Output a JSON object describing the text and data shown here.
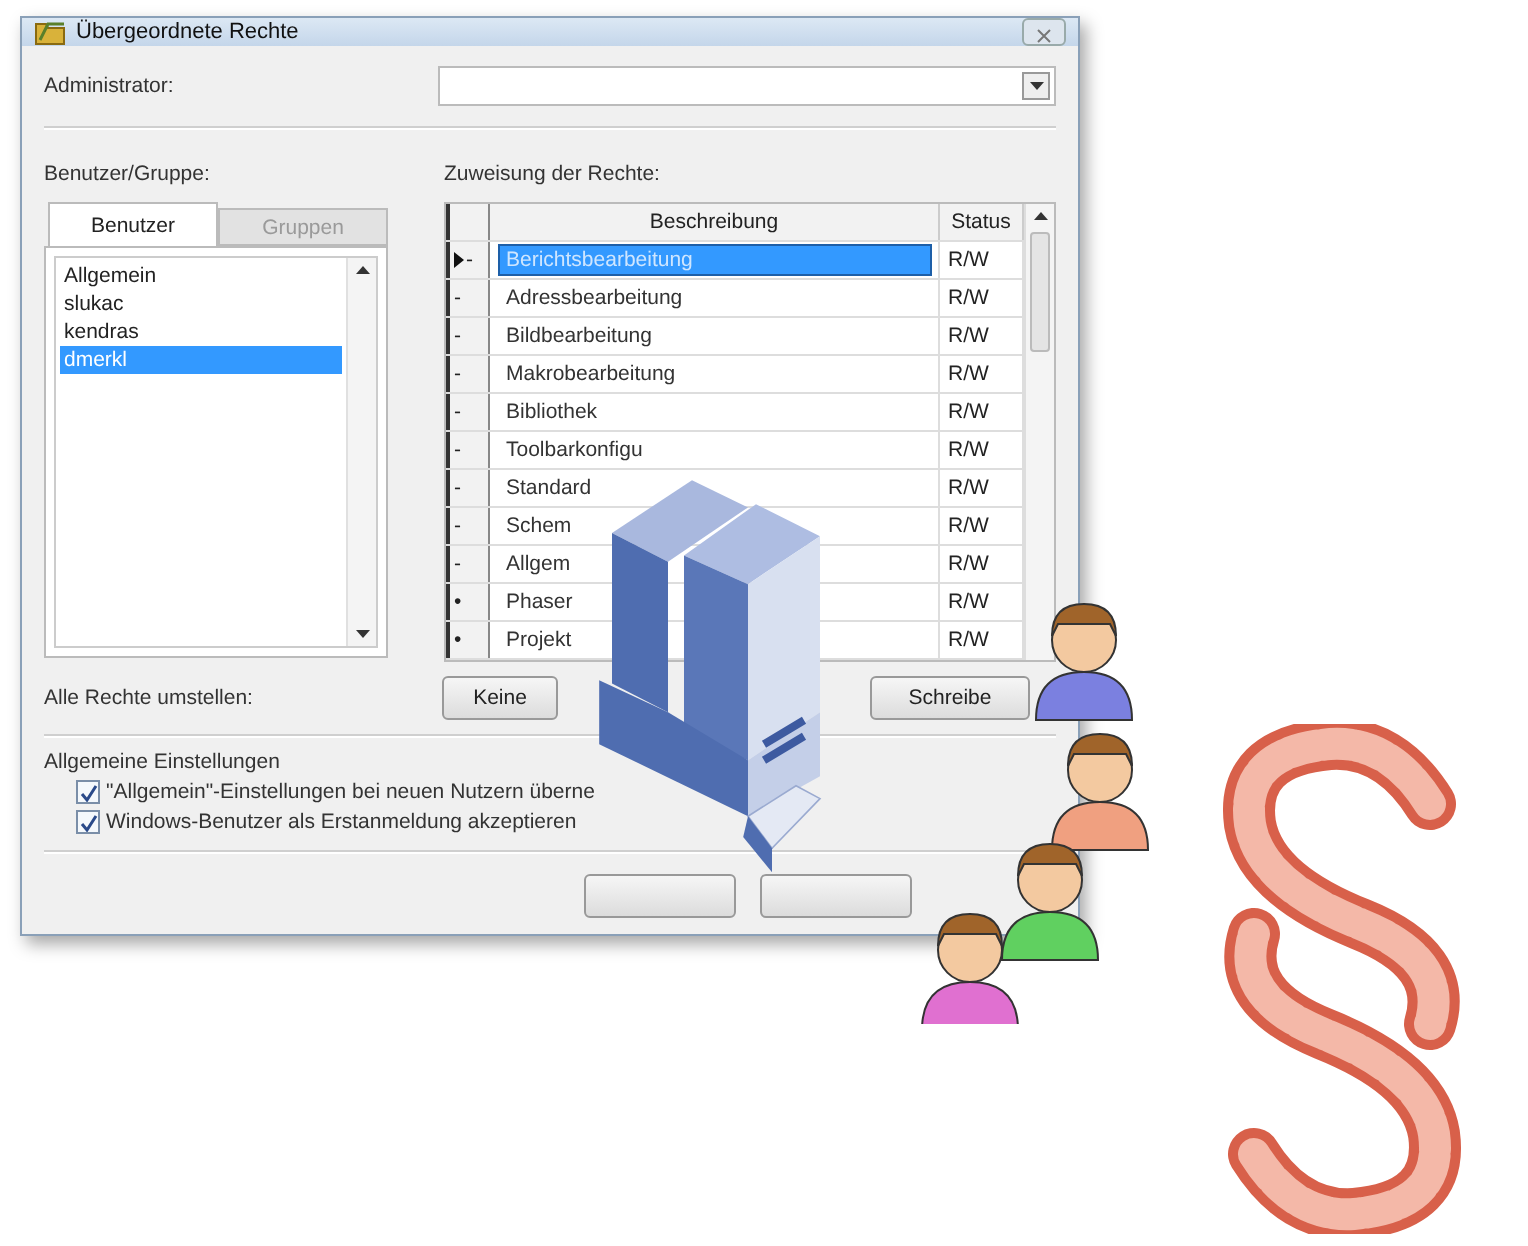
{
  "window": {
    "title": "Übergeordnete Rechte"
  },
  "administrator": {
    "label": "Administrator:"
  },
  "users_panel": {
    "label": "Benutzer/Gruppe:",
    "tabs": [
      {
        "label": "Benutzer",
        "selected": true
      },
      {
        "label": "Gruppen",
        "selected": false
      }
    ],
    "items": [
      {
        "label": "Allgemein",
        "selected": false
      },
      {
        "label": "slukac",
        "selected": false
      },
      {
        "label": "kendras",
        "selected": false
      },
      {
        "label": "dmerkl",
        "selected": true
      }
    ]
  },
  "rights": {
    "label": "Zuweisung der Rechte:",
    "columns": [
      "Beschreibung",
      "Status"
    ],
    "rows": [
      {
        "current": true,
        "marker": "-",
        "description": "Berichtsbearbeitung",
        "status": "R/W",
        "selected": true
      },
      {
        "current": false,
        "marker": "-",
        "description": "Adressbearbeitung",
        "status": "R/W",
        "selected": false
      },
      {
        "current": false,
        "marker": "-",
        "description": "Bildbearbeitung",
        "status": "R/W",
        "selected": false
      },
      {
        "current": false,
        "marker": "-",
        "description": "Makrobearbeitung",
        "status": "R/W",
        "selected": false
      },
      {
        "current": false,
        "marker": "-",
        "description": "Bibliothek",
        "status": "R/W",
        "selected": false
      },
      {
        "current": false,
        "marker": "-",
        "description": "Toolbarkonfigu",
        "status": "R/W",
        "selected": false
      },
      {
        "current": false,
        "marker": "-",
        "description": "Standard",
        "status": "R/W",
        "selected": false
      },
      {
        "current": false,
        "marker": "-",
        "description": "Schem",
        "status": "R/W",
        "selected": false
      },
      {
        "current": false,
        "marker": "-",
        "description": "Allgem",
        "status": "R/W",
        "selected": false
      },
      {
        "current": false,
        "marker": "•",
        "description": "Phaser",
        "status": "R/W",
        "selected": false
      },
      {
        "current": false,
        "marker": "•",
        "description": "Projekt",
        "status": "R/W",
        "selected": false
      }
    ]
  },
  "reset": {
    "label": "Alle Rechte umstellen:",
    "buttons": [
      "Keine",
      "Schreibe"
    ]
  },
  "general": {
    "title": "Allgemeine Einstellungen",
    "options": [
      {
        "label": "\"Allgemein\"-Einstellungen bei neuen Nutzern überne",
        "checked": true
      },
      {
        "label": "Windows-Benutzer als Erstanmeldung akzeptieren",
        "checked": true
      }
    ]
  }
}
